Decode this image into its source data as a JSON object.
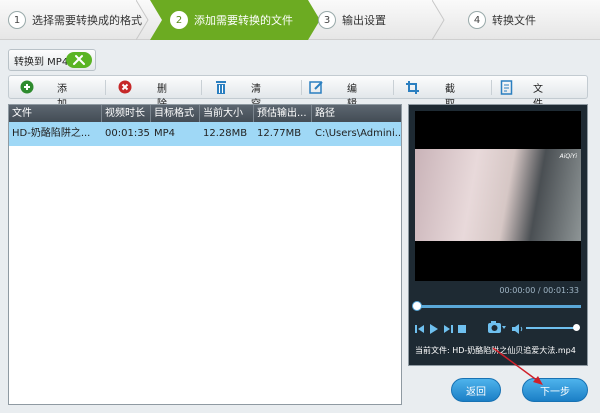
{
  "steps": [
    {
      "num": "1",
      "label": "选择需要转换成的格式"
    },
    {
      "num": "2",
      "label": "添加需要转换的文件"
    },
    {
      "num": "3",
      "label": "输出设置"
    },
    {
      "num": "4",
      "label": "转换文件"
    }
  ],
  "active_step": 2,
  "convert_button": {
    "label": "转换到 MP4",
    "icon": "tools-icon"
  },
  "toolbar": {
    "add": {
      "label": "添加",
      "icon": "plus-circle-icon"
    },
    "delete": {
      "label": "删除",
      "icon": "x-circle-icon"
    },
    "clear": {
      "label": "清空",
      "icon": "trash-icon"
    },
    "edit": {
      "label": "编辑",
      "icon": "edit-icon"
    },
    "crop": {
      "label": "截取",
      "icon": "crop-icon"
    },
    "info": {
      "label": "文件信息",
      "icon": "info-doc-icon"
    }
  },
  "table": {
    "columns": [
      "文件",
      "视频时长",
      "目标格式",
      "当前大小",
      "预估输出...",
      "路径"
    ],
    "rows": [
      [
        "HD-奶酪陷阱之...",
        "00:01:35",
        "MP4",
        "12.28MB",
        "12.77MB",
        "C:\\Users\\Admini..."
      ]
    ]
  },
  "player": {
    "time": "00:00:00 / 00:01:33",
    "current_file": "当前文件: HD-奶酪陷阱之仙贝追爱大法.mp4",
    "watermark": "AiQiYi"
  },
  "buttons": {
    "back": "返回",
    "next": "下一步"
  },
  "colors": {
    "step_active": "#6cab22",
    "row_selected": "#9fd8f6",
    "button_blue": "#1b7fc6",
    "arrow": "#d0202a"
  }
}
